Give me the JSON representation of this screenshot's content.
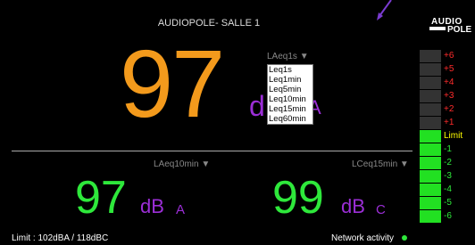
{
  "header": {
    "title": "AUDIOPOLE- SALLE 1"
  },
  "logo": {
    "line1": "AUDIO",
    "line2": "POLE"
  },
  "main_meter": {
    "value": "97",
    "unit_db": "d",
    "unit_weighting": "A",
    "selected_option": "LAeq1s ▼",
    "options": [
      "Leq1s",
      "Leq1min",
      "Leq5min",
      "Leq10min",
      "Leq15min",
      "Leq60min"
    ],
    "value_color": "#f39a1c",
    "unit_color": "#9b2ed6"
  },
  "left_meter": {
    "label": "LAeq10min ▼",
    "value": "97",
    "unit_db": "dB",
    "unit_weighting": "A",
    "value_color": "#2ee83b"
  },
  "right_meter": {
    "label": "LCeq15min ▼",
    "value": "99",
    "unit_db": "dB",
    "unit_weighting": "C",
    "value_color": "#2ee83b"
  },
  "footer": {
    "limit": "Limit : 102dBA / 118dBC",
    "network": "Network activity"
  },
  "level_bar": {
    "labels": [
      "+6",
      "+5",
      "+4",
      "+3",
      "+2",
      "+1",
      "Limit",
      "-1",
      "-2",
      "-3",
      "-4",
      "-5",
      "-6"
    ],
    "label_colors": [
      "#ff2b2b",
      "#ff2b2b",
      "#ff2b2b",
      "#ff2b2b",
      "#ff2b2b",
      "#ff2b2b",
      "#ffff00",
      "#2ee83b",
      "#2ee83b",
      "#2ee83b",
      "#2ee83b",
      "#2ee83b",
      "#2ee83b"
    ],
    "active_from_index": 6,
    "on_color": "#22e022",
    "off_color": "#333333"
  }
}
